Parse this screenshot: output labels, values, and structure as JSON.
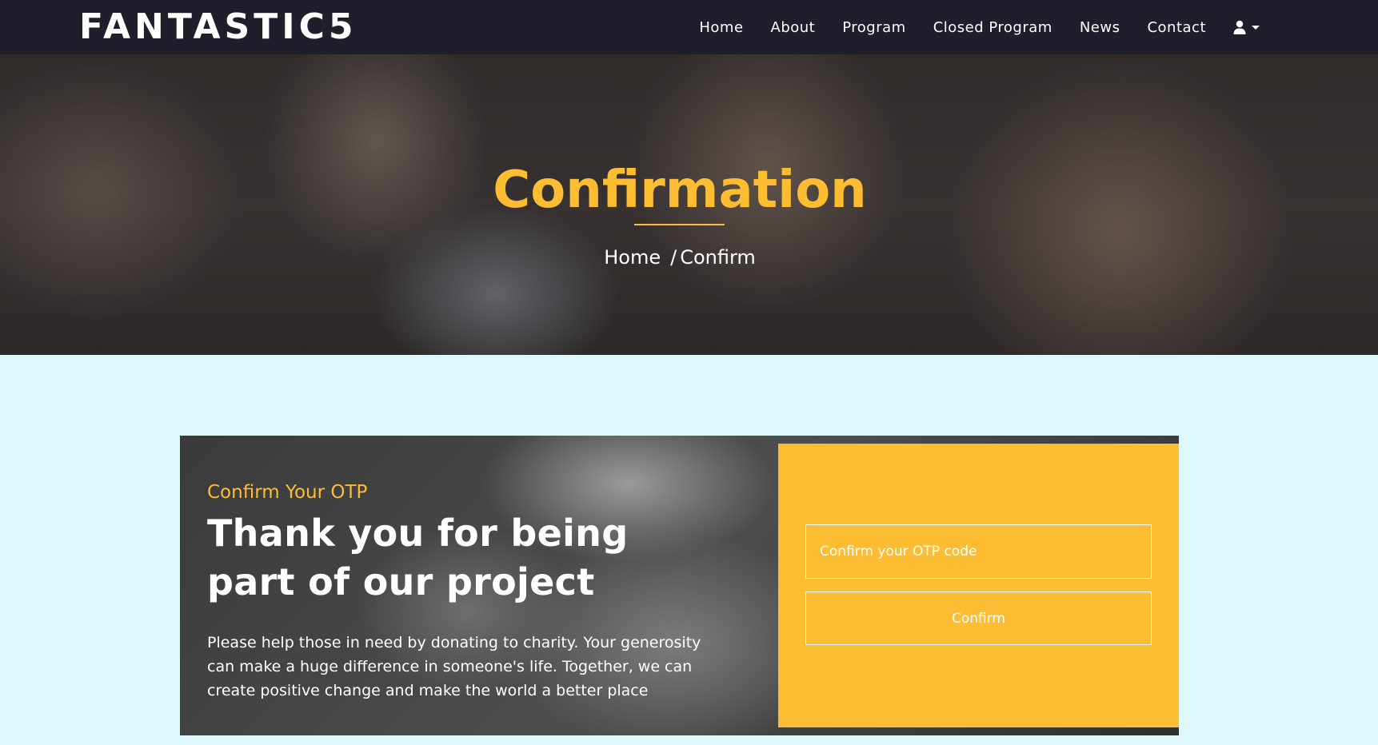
{
  "navbar": {
    "brand": "FANTASTIC5",
    "links": [
      "Home",
      "About",
      "Program",
      "Closed Program",
      "News",
      "Contact"
    ],
    "user_icon": "user-icon"
  },
  "hero": {
    "title": "Confirmation",
    "breadcrumb": {
      "home": "Home",
      "separator": "/",
      "current": "Confirm"
    }
  },
  "card": {
    "subtitle": "Confirm Your OTP",
    "heading": "Thank you for being part of our project",
    "text": "Please help those in need by donating to charity. Your generosity can make a huge difference in someone's life. Together, we can create positive change and make the world a better place",
    "form": {
      "otp_placeholder": "Confirm your OTP code",
      "otp_value": "",
      "confirm_label": "Confirm"
    }
  },
  "colors": {
    "navbar_bg": "#1e1f2b",
    "accent": "#fcbd33",
    "page_bg": "#dcf8fb"
  }
}
